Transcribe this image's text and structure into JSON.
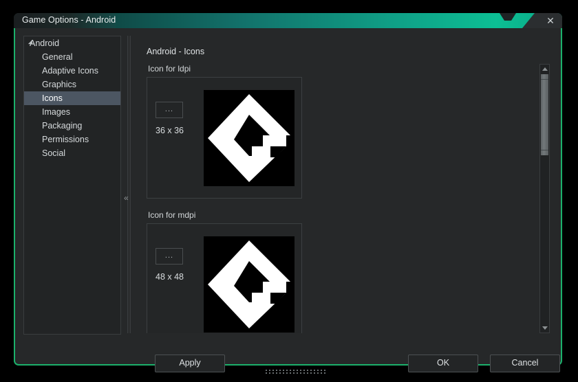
{
  "window": {
    "title": "Game Options - Android",
    "close_icon": "close-icon",
    "close_glyph": "✕",
    "accent_color": "#0fa489",
    "border_color": "#1bb16b",
    "body_color": "#262829"
  },
  "sidebar": {
    "items": [
      {
        "label": "Android",
        "level": 0,
        "selected": false,
        "expander": true
      },
      {
        "label": "General",
        "level": 1,
        "selected": false,
        "expander": false
      },
      {
        "label": "Adaptive Icons",
        "level": 1,
        "selected": false,
        "expander": false
      },
      {
        "label": "Graphics",
        "level": 1,
        "selected": false,
        "expander": false
      },
      {
        "label": "Icons",
        "level": 1,
        "selected": true,
        "expander": false
      },
      {
        "label": "Images",
        "level": 1,
        "selected": false,
        "expander": false
      },
      {
        "label": "Packaging",
        "level": 1,
        "selected": false,
        "expander": false
      },
      {
        "label": "Permissions",
        "level": 1,
        "selected": false,
        "expander": false
      },
      {
        "label": "Social",
        "level": 1,
        "selected": false,
        "expander": false
      }
    ],
    "selected_highlight": "#4c5662"
  },
  "splitter": {
    "collapse_glyph": "«",
    "collapse_name": "collapse-sidebar-chevron-icon"
  },
  "main": {
    "title": "Android - Icons",
    "groups": [
      {
        "label": "Icon for ldpi",
        "browse_label": "...",
        "size_label": "36 x 36",
        "preview_name": "gamemaker-logo-icon"
      },
      {
        "label": "Icon for mdpi",
        "browse_label": "...",
        "size_label": "48 x 48",
        "preview_name": "gamemaker-logo-icon"
      }
    ]
  },
  "scrollbar": {
    "up_arrow": "scroll-up-arrow-icon",
    "down_arrow": "scroll-down-arrow-icon",
    "thumb_name": "scroll-thumb"
  },
  "footer": {
    "apply_label": "Apply",
    "ok_label": "OK",
    "cancel_label": "Cancel"
  }
}
